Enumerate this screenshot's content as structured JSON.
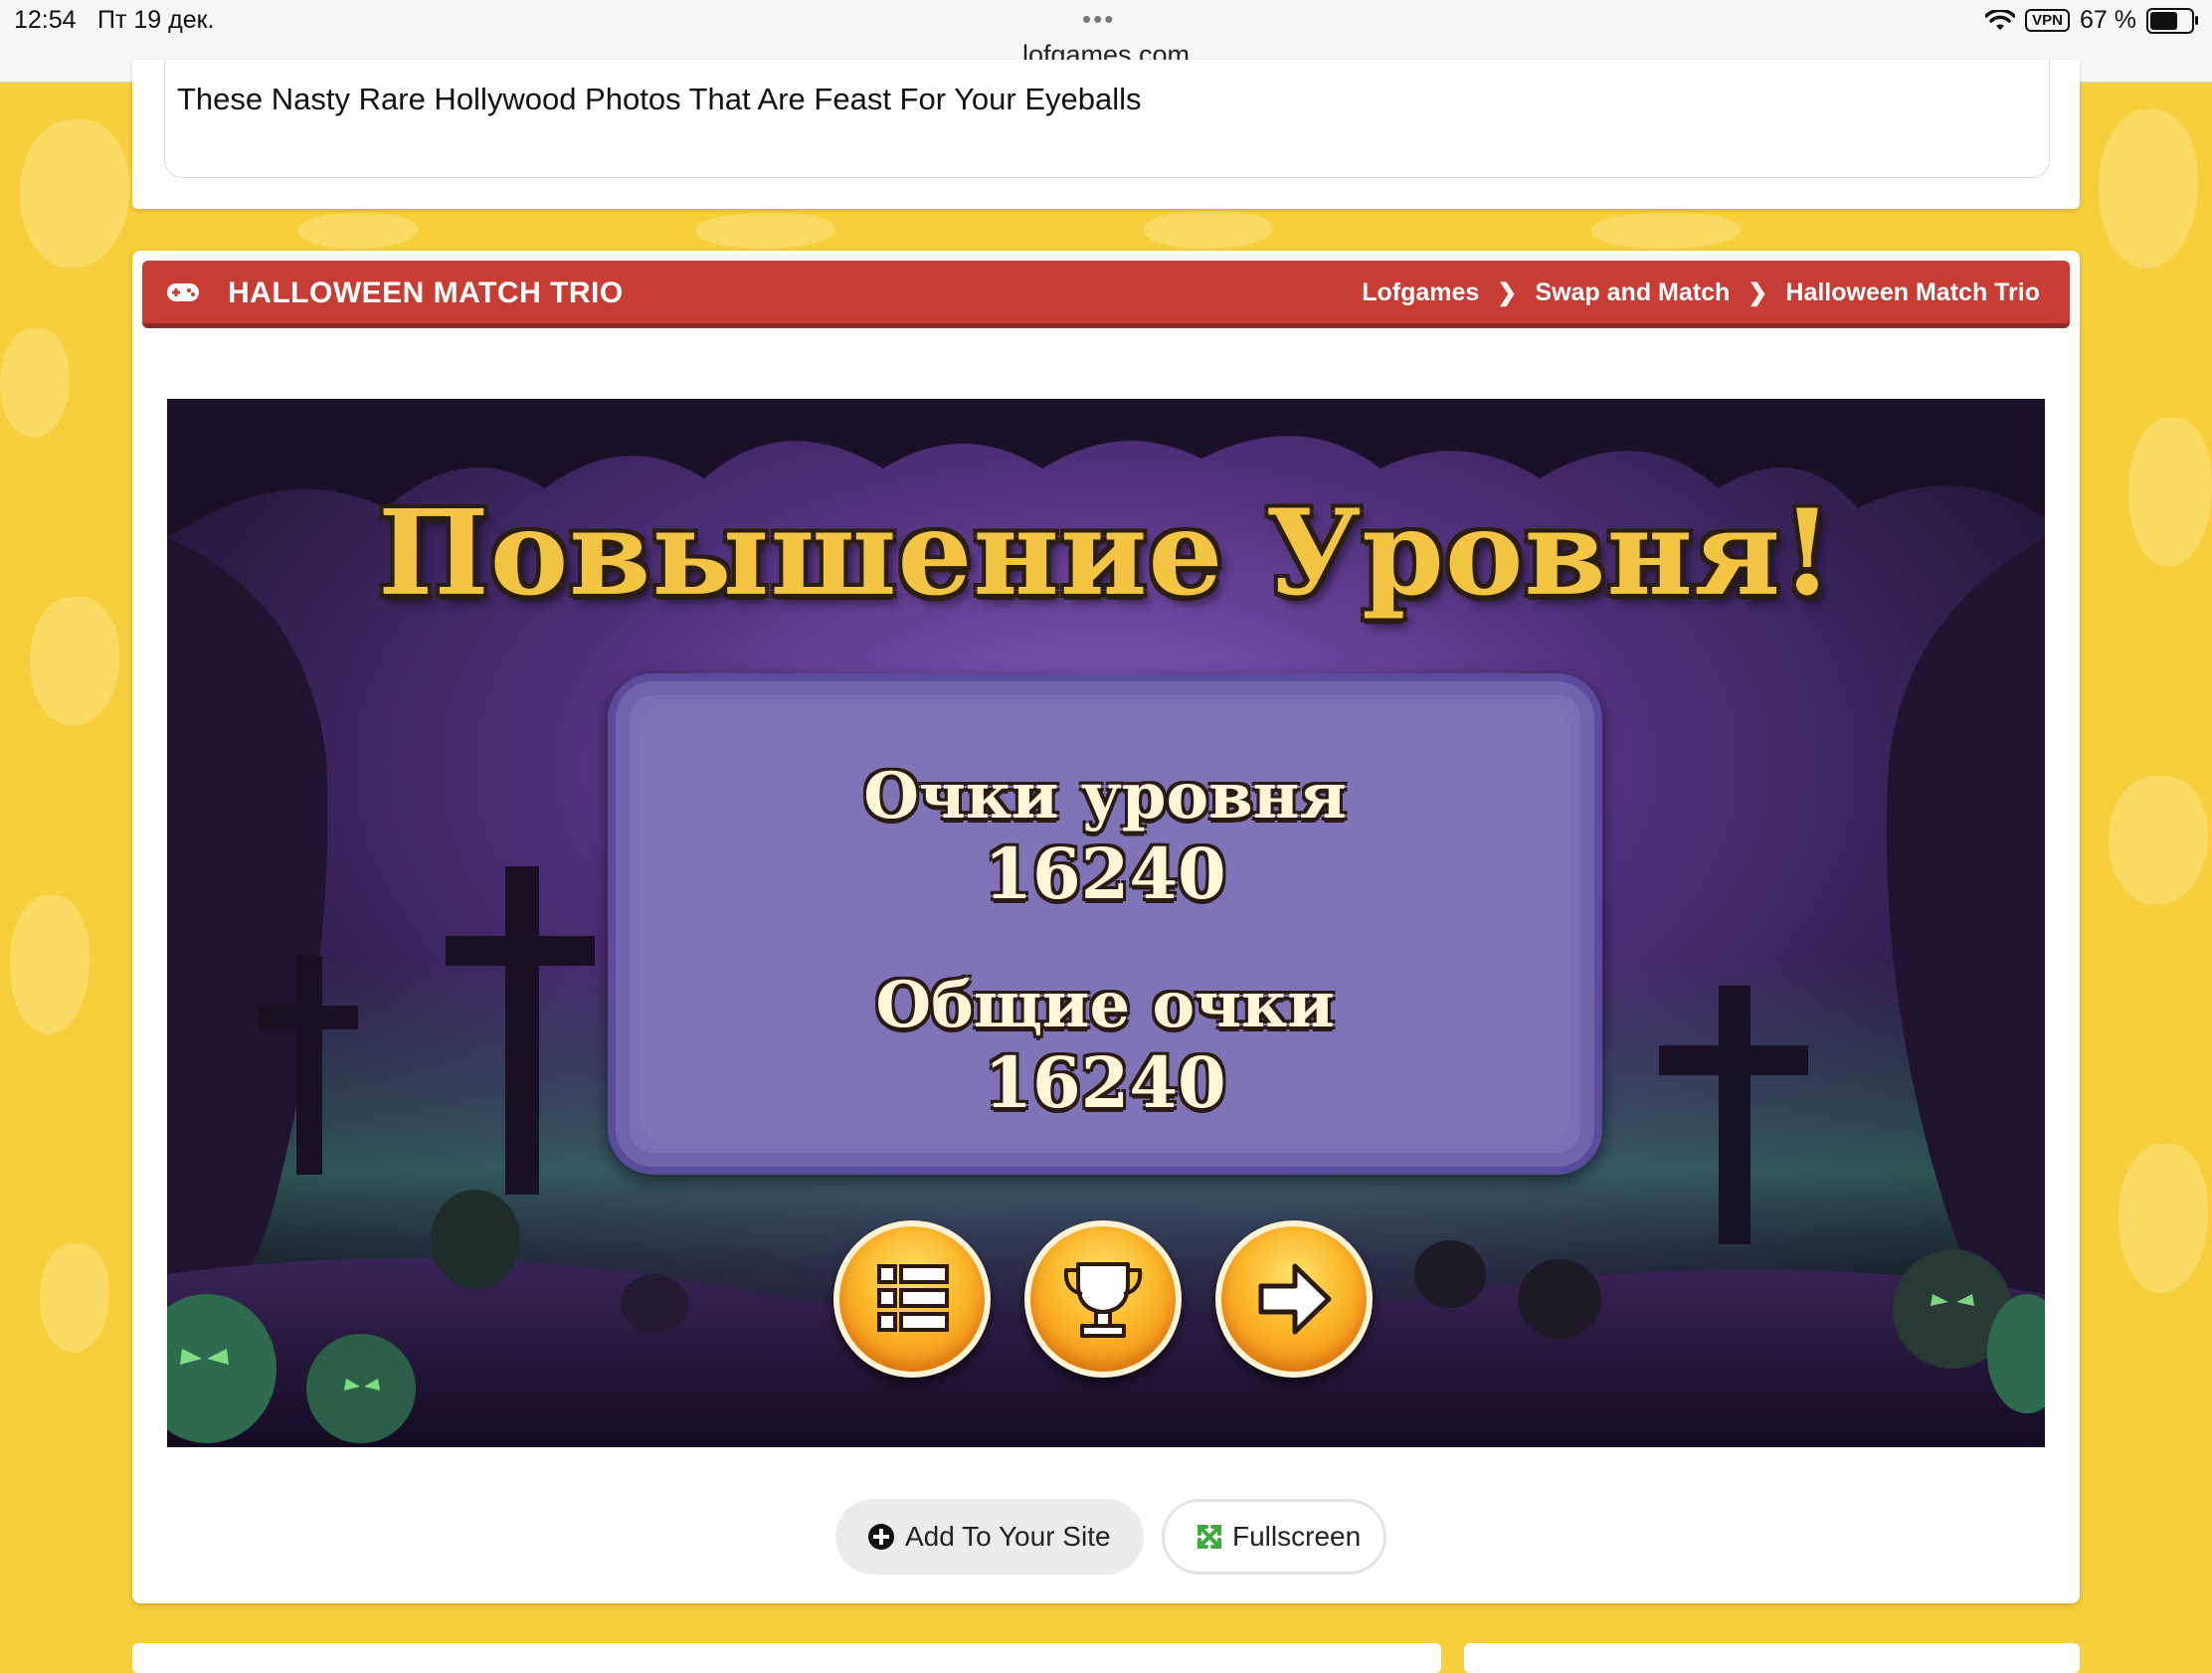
{
  "status_bar": {
    "time": "12:54",
    "date": "Пт 19 дек.",
    "dots": "•••",
    "url": "lofgames.com",
    "vpn": "VPN",
    "battery": "67 %"
  },
  "ad": {
    "text": "These Nasty Rare Hollywood Photos That Are Feast For Your Eyeballs"
  },
  "game_header": {
    "title": "HALLOWEEN MATCH TRIO",
    "breadcrumbs": [
      "Lofgames",
      "Swap and Match",
      "Halloween Match Trio"
    ]
  },
  "game": {
    "heading": "Повышение Уровня!",
    "level_score_label": "Очки уровня",
    "level_score": "16240",
    "total_score_label": "Общие очки",
    "total_score": "16240"
  },
  "actions": {
    "add_label": "Add To Your Site",
    "fullscreen_label": "Fullscreen"
  },
  "colors": {
    "page_bg": "#f7cf3c",
    "header_red": "#c73d34",
    "title_gold": "#f4c443",
    "panel_purple": "#7b6fb5",
    "button_orange": "#fbb62a"
  }
}
